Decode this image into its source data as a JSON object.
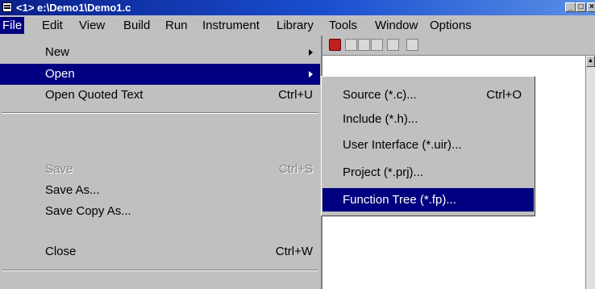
{
  "window": {
    "title": "<1> e:\\Demo1\\Demo1.c",
    "min": "_",
    "max": "□",
    "close": "×"
  },
  "menubar": {
    "items": [
      "File",
      "Edit",
      "View",
      "Build",
      "Run",
      "Instrument",
      "Library",
      "Tools",
      "Window",
      "Options"
    ]
  },
  "file_menu": {
    "new": "New",
    "open": "Open",
    "open_quoted": "Open Quoted Text",
    "open_quoted_shortcut": "Ctrl+U",
    "save": "Save",
    "save_shortcut": "Ctrl+S",
    "save_as": "Save As...",
    "save_copy_as": "Save Copy As...",
    "close": "Close",
    "close_shortcut": "Ctrl+W"
  },
  "open_submenu": {
    "items": [
      {
        "label": "Source (*.c)...",
        "shortcut": "Ctrl+O"
      },
      {
        "label": "Include (*.h)...",
        "shortcut": ""
      },
      {
        "label": "User Interface (*.uir)...",
        "shortcut": ""
      },
      {
        "label": "Project (*.prj)...",
        "shortcut": ""
      },
      {
        "label": "Function Tree (*.fp)...",
        "shortcut": ""
      }
    ]
  },
  "colors": {
    "highlight": "#000080",
    "face": "#c0c0c0",
    "title_start": "#0a1f8a"
  }
}
